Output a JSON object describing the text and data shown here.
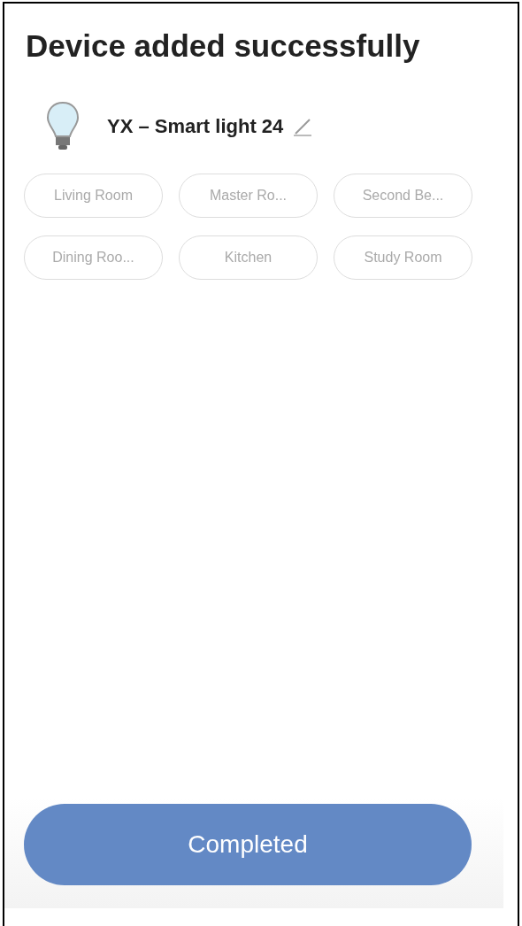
{
  "title": "Device added successfully",
  "device": {
    "name": "YX – Smart light 24"
  },
  "rooms": [
    {
      "label": "Living Room"
    },
    {
      "label": "Master Ro..."
    },
    {
      "label": "Second Be..."
    },
    {
      "label": "Dining Roo..."
    },
    {
      "label": "Kitchen"
    },
    {
      "label": "Study Room"
    }
  ],
  "button": "Completed"
}
